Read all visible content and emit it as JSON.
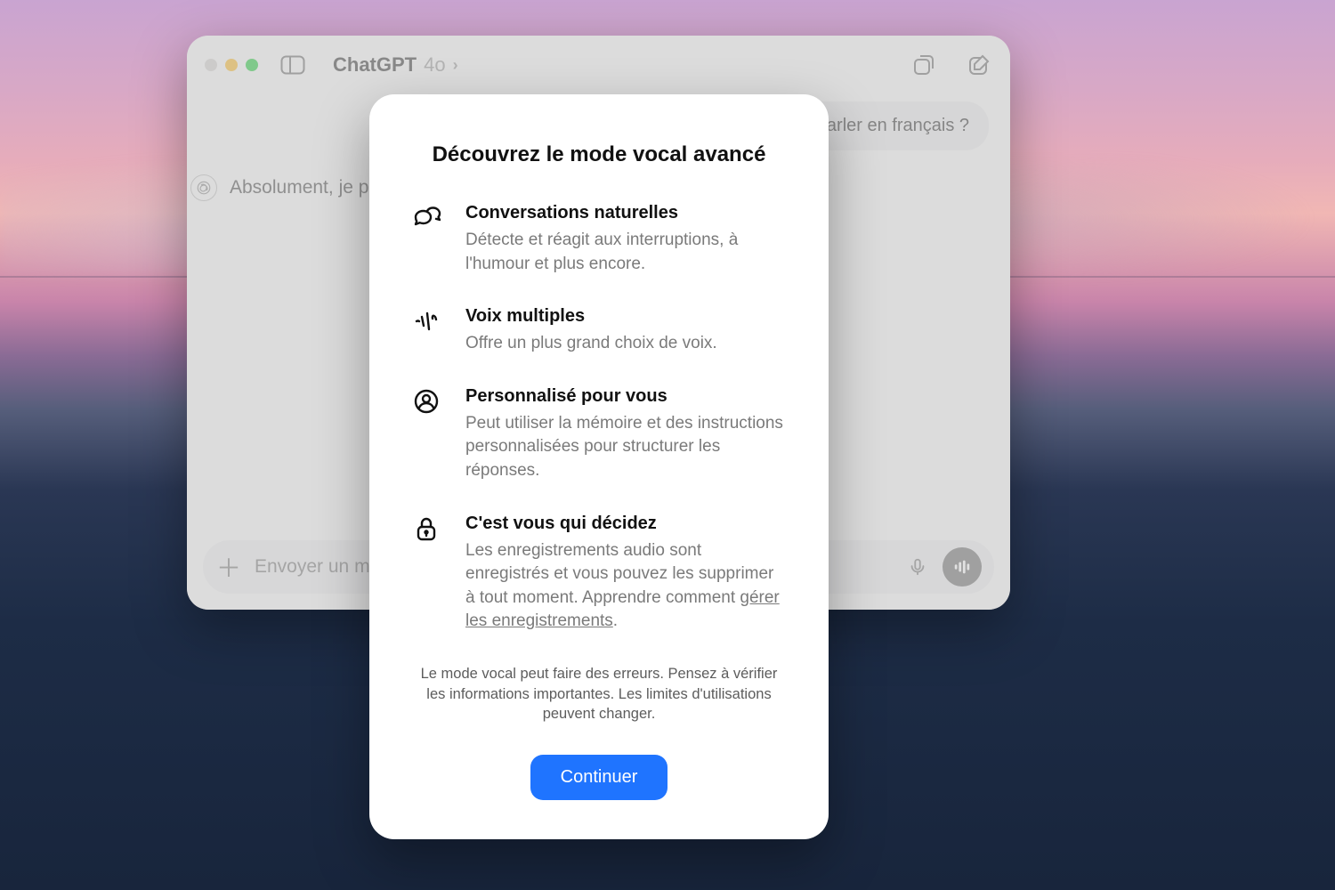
{
  "window": {
    "app_name": "ChatGPT",
    "model": "4o"
  },
  "chat": {
    "user_msg": "parler en français ?",
    "assistant_prefix": "Absolument, je pa",
    "composer_placeholder": "Envoyer un mes"
  },
  "modal": {
    "title": "Découvrez le mode vocal avancé",
    "features": [
      {
        "title": "Conversations naturelles",
        "desc": "Détecte et réagit aux interruptions, à l'humour et plus encore."
      },
      {
        "title": "Voix multiples",
        "desc": "Offre un plus grand choix de voix."
      },
      {
        "title": "Personnalisé pour vous",
        "desc": "Peut utiliser la mémoire et des instructions personnalisées pour structurer les réponses."
      },
      {
        "title": "C'est vous qui décidez",
        "desc_prefix": "Les enregistrements audio sont enregistrés et vous pouvez les supprimer à tout moment. Apprendre comment ",
        "link_text": "gérer les enregistrements",
        "desc_suffix": "."
      }
    ],
    "disclaimer": "Le mode vocal peut faire des erreurs. Pensez à vérifier les informations importantes. Les limites d'utilisations peuvent changer.",
    "cta": "Continuer"
  }
}
